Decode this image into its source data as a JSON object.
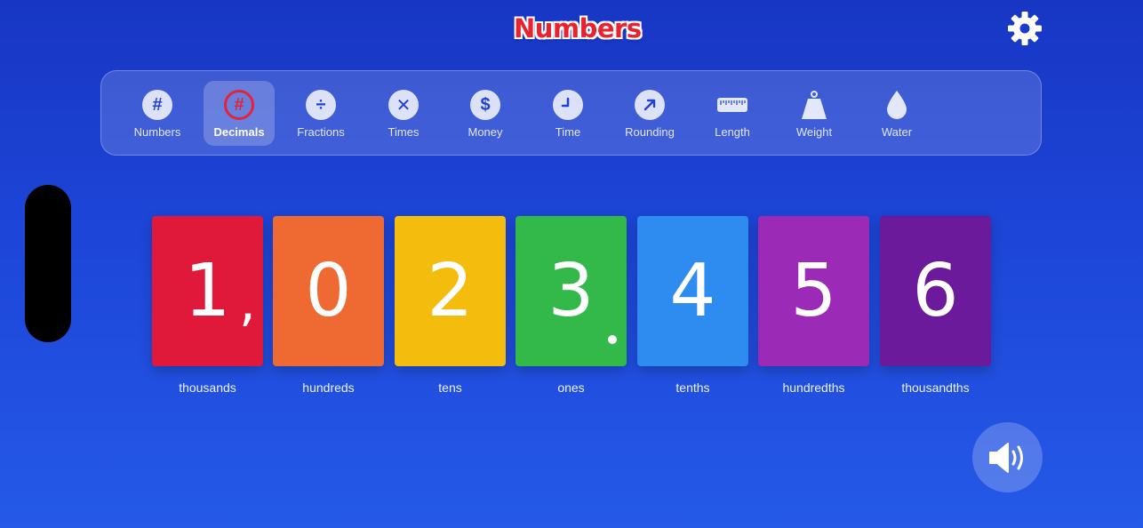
{
  "app": {
    "logo_text": "Numbers"
  },
  "toolbar": {
    "items": [
      {
        "label": "Numbers",
        "glyph": "#",
        "icon": "hash-icon",
        "active": false
      },
      {
        "label": "Decimals",
        "glyph": "#",
        "icon": "hash-icon",
        "active": true
      },
      {
        "label": "Fractions",
        "glyph": "÷",
        "icon": "divide-icon",
        "active": false
      },
      {
        "label": "Times",
        "glyph": "✕",
        "icon": "times-icon",
        "active": false
      },
      {
        "label": "Money",
        "glyph": "$",
        "icon": "dollar-icon",
        "active": false
      },
      {
        "label": "Time",
        "glyph": "",
        "icon": "clock-icon",
        "active": false
      },
      {
        "label": "Rounding",
        "glyph": "",
        "icon": "arrow-up-right-icon",
        "active": false
      },
      {
        "label": "Length",
        "glyph": "",
        "icon": "ruler-icon",
        "active": false
      },
      {
        "label": "Weight",
        "glyph": "",
        "icon": "weight-icon",
        "active": false
      },
      {
        "label": "Water",
        "glyph": "",
        "icon": "water-drop-icon",
        "active": false
      }
    ]
  },
  "cards": [
    {
      "digit": "1",
      "separator": ",",
      "place": "thousands",
      "color": "#e0193a"
    },
    {
      "digit": "0",
      "separator": "",
      "place": "hundreds",
      "color": "#ef6a33"
    },
    {
      "digit": "2",
      "separator": "",
      "place": "tens",
      "color": "#f4bd0d"
    },
    {
      "digit": "3",
      "separator": ".",
      "place": "ones",
      "color": "#33b84a"
    },
    {
      "digit": "4",
      "separator": "",
      "place": "tenths",
      "color": "#2e8cf0"
    },
    {
      "digit": "5",
      "separator": "",
      "place": "hundredths",
      "color": "#9b2bb6"
    },
    {
      "digit": "6",
      "separator": "",
      "place": "thousandths",
      "color": "#6b1a9c"
    }
  ],
  "icons": {
    "settings": "gear-icon",
    "sound": "speaker-icon"
  }
}
